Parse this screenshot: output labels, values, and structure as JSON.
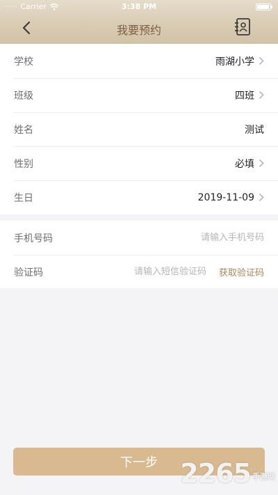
{
  "status_bar": {
    "carrier": "Carrier",
    "time": "3:38 PM"
  },
  "nav": {
    "title": "我要预约",
    "back_icon": "chevron-left-icon",
    "contact_icon": "contact-book-icon"
  },
  "form": {
    "school": {
      "label": "学校",
      "value": "雨湖小学"
    },
    "class": {
      "label": "班级",
      "value": "四班"
    },
    "name": {
      "label": "姓名",
      "value": "测试"
    },
    "gender": {
      "label": "性别",
      "value": "必填"
    },
    "birthday": {
      "label": "生日",
      "value": "2019-11-09"
    },
    "phone": {
      "label": "手机号码",
      "placeholder": "请输入手机号码"
    },
    "code": {
      "label": "验证码",
      "placeholder": "请输入短信验证码",
      "button": "获取验证码"
    }
  },
  "next_button": "下一步",
  "watermark": {
    "number": "2265",
    "text": "手游网"
  },
  "colors": {
    "accent": "#a8875d",
    "title": "#7a5f3f",
    "button": "#d9b990"
  }
}
